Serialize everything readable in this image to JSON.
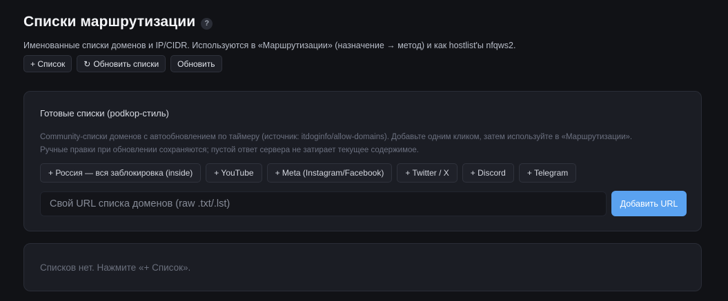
{
  "header": {
    "title": "Списки маршрутизации",
    "help": "?",
    "subtitle": "Именованные списки доменов и IP/CIDR. Используются в «Маршрутизации» (назначение → метод) и как hostlist'ы nfqws2."
  },
  "toolbar": {
    "add_list_label": "+ Список",
    "update_lists_icon": "↻",
    "update_lists_label": "Обновить списки",
    "refresh_label": "Обновить"
  },
  "presets": {
    "title": "Готовые списки (podkop-стиль)",
    "description": "Community-списки доменов с автообновлением по таймеру (источник: itdoginfo/allow-domains). Добавьте одним кликом, затем используйте в «Маршрутизации». Ручные правки при обновлении сохраняются; пустой ответ сервера не затирает текущее содержимое.",
    "chips": [
      "+ Россия — вся заблокировка (inside)",
      "+ YouTube",
      "+ Meta (Instagram/Facebook)",
      "+ Twitter / X",
      "+ Discord",
      "+ Telegram"
    ],
    "url_placeholder": "Свой URL списка доменов (raw .txt/.lst)",
    "url_value": "",
    "add_url_label": "Добавить URL"
  },
  "empty_state": {
    "text": "Списков нет. Нажмите «+ Список»."
  },
  "colors": {
    "background": "#111216",
    "card": "#1b1d24",
    "accent": "#5aa2f0"
  }
}
